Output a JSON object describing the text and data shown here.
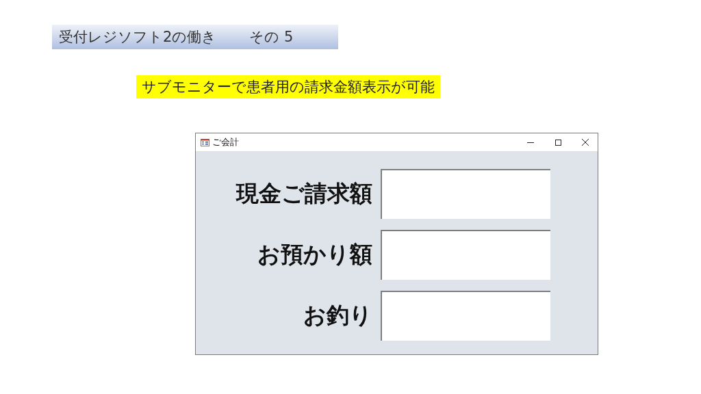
{
  "slide": {
    "title": "受付レジソフト2の働き",
    "title_part": "その 5",
    "note": "サブモニターで患者用の請求金額表示が可能"
  },
  "window": {
    "title": "ご会計"
  },
  "fields": [
    {
      "label": "現金ご請求額"
    },
    {
      "label": "お預かり額"
    },
    {
      "label": "お釣り"
    }
  ]
}
